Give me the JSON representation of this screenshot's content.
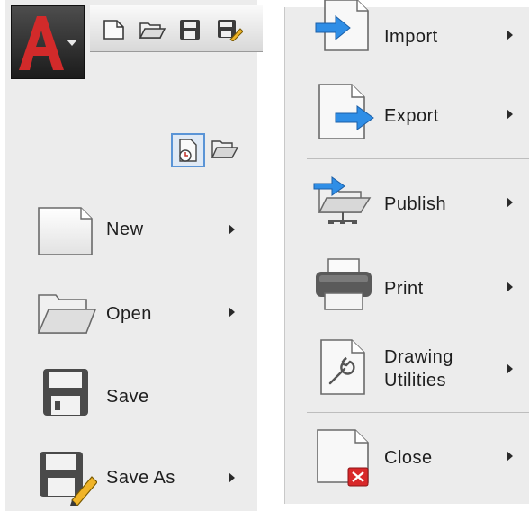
{
  "left_menu": {
    "items": [
      {
        "label": "New"
      },
      {
        "label": "Open"
      },
      {
        "label": "Save"
      },
      {
        "label": "Save As"
      }
    ]
  },
  "right_menu": {
    "items": [
      {
        "label": "Import"
      },
      {
        "label": "Export"
      },
      {
        "label": "Publish"
      },
      {
        "label": "Print"
      },
      {
        "label_line1": "Drawing",
        "label_line2": "Utilities"
      },
      {
        "label": "Close"
      }
    ]
  },
  "colors": {
    "app_red": "#d22a2a",
    "accent_blue": "#2f8ee6",
    "close_red": "#d8282a",
    "panel_bg": "#ececec"
  },
  "icons": {
    "app": "autocad-a-logo",
    "qat": [
      "new-icon",
      "open-icon",
      "save-icon",
      "save-as-icon"
    ],
    "view": [
      "recent-documents-icon",
      "open-documents-icon"
    ]
  }
}
